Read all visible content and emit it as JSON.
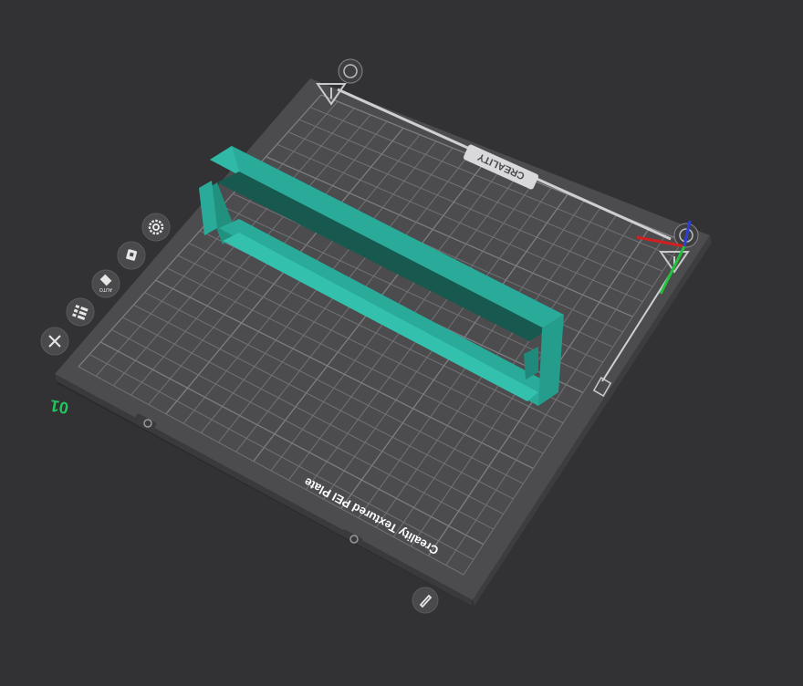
{
  "viewport": {
    "background_color": "#323234",
    "plate_color": "#4c4c4f",
    "model_color": "#2aab9a"
  },
  "plate": {
    "number": "01",
    "brand_label": "CREALITY",
    "surface_label": "Creality Textured PEI Plate"
  },
  "plate_tools": [
    {
      "id": "settings",
      "icon": "gear-icon"
    },
    {
      "id": "lock",
      "icon": "lock-icon"
    },
    {
      "id": "auto-orient",
      "icon": "auto-orient-icon",
      "label": "AUTO"
    },
    {
      "id": "arrange",
      "icon": "arrange-icon"
    },
    {
      "id": "close",
      "icon": "close-icon"
    }
  ],
  "corner_tool": {
    "icon": "edit-plate-icon"
  },
  "axes": {
    "x_color": "#d21f1f",
    "y_color": "#1fc23a",
    "z_color": "#2b3ed6"
  },
  "model": {
    "name": "elongated tray part"
  }
}
